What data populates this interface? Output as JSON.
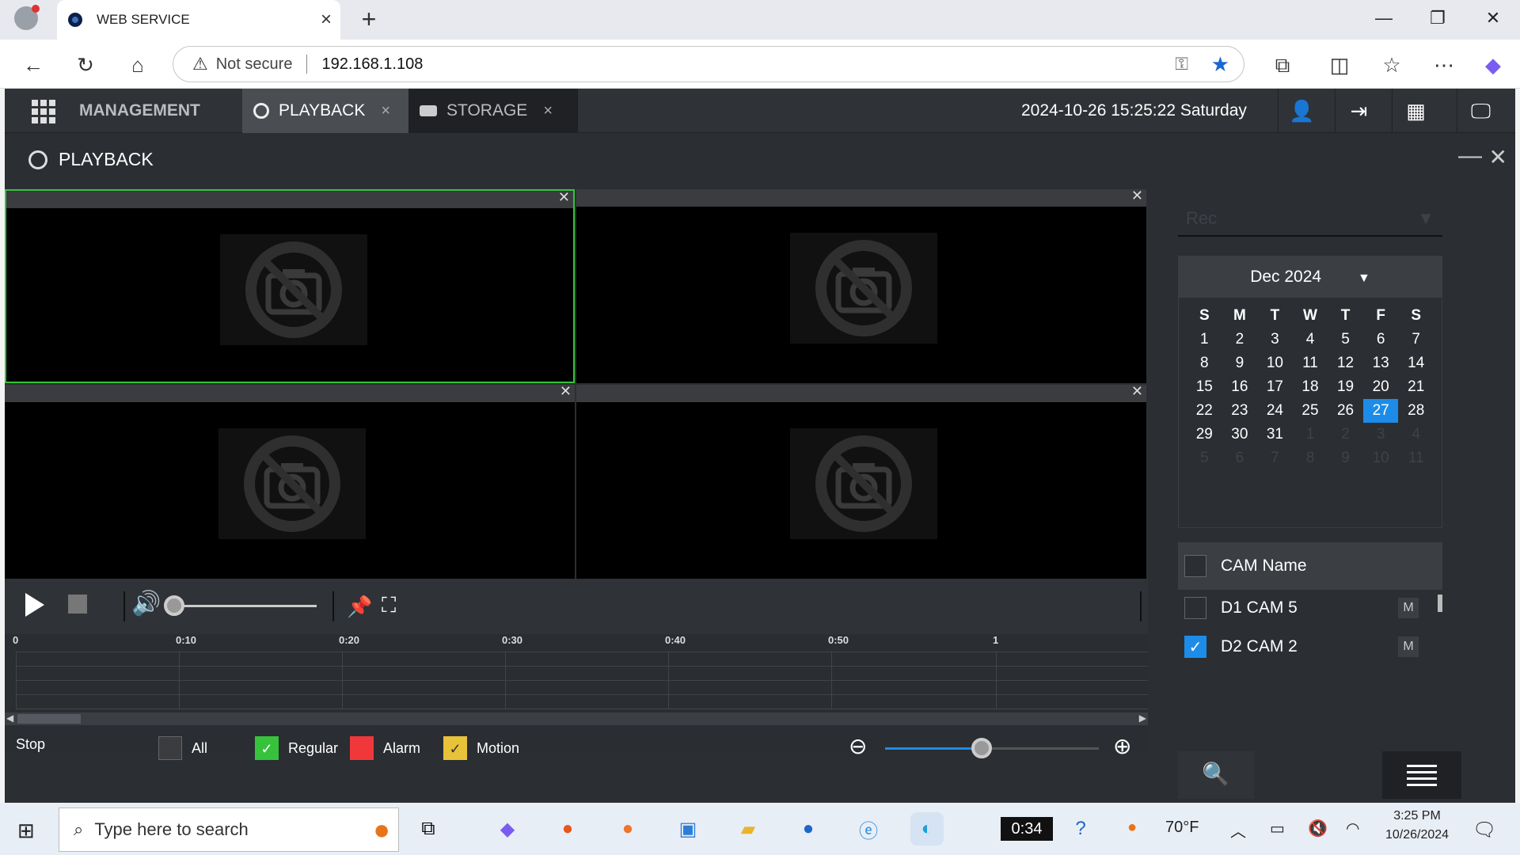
{
  "browser": {
    "tab_title": "WEB SERVICE",
    "security": "Not secure",
    "url": "192.168.1.108"
  },
  "app": {
    "tabs": [
      {
        "label": "MANAGEMENT"
      },
      {
        "label": "PLAYBACK",
        "close": "×"
      },
      {
        "label": "STORAGE",
        "close": "×"
      }
    ],
    "datetime": "2024-10-26 15:25:22 Saturday",
    "panel_title": "PLAYBACK",
    "timeline_ticks": [
      "0",
      "0:10",
      "0:20",
      "0:30",
      "0:40",
      "0:50",
      "1"
    ],
    "status": "Stop",
    "legend": [
      {
        "label": "All",
        "color": "#3a3c40"
      },
      {
        "label": "Regular",
        "color": "#37c23c"
      },
      {
        "label": "Alarm",
        "color": "#f0383a"
      },
      {
        "label": "Motion",
        "color": "#e8c33a"
      }
    ],
    "volume_level": 0.0,
    "zoom_level": 0.45
  },
  "sidebar": {
    "rec_placeholder": "Rec",
    "month": "Dec 2024",
    "weekdays": [
      "S",
      "M",
      "T",
      "W",
      "T",
      "F",
      "S"
    ],
    "days": [
      "1",
      "2",
      "3",
      "4",
      "5",
      "6",
      "7",
      "8",
      "9",
      "10",
      "11",
      "12",
      "13",
      "14",
      "15",
      "16",
      "17",
      "18",
      "19",
      "20",
      "21",
      "22",
      "23",
      "24",
      "25",
      "26",
      "27",
      "28",
      "29",
      "30",
      "31",
      "1",
      "2",
      "3",
      "4",
      "5",
      "6",
      "7",
      "8",
      "9",
      "10",
      "11"
    ],
    "selected_day": "27",
    "cam_header": "CAM Name",
    "cams": [
      {
        "name": "D1 CAM 5",
        "checked": false,
        "tag": "M"
      },
      {
        "name": "D2 CAM 2",
        "checked": true,
        "tag": "M"
      }
    ]
  },
  "taskbar": {
    "search_placeholder": "Type here to search",
    "timer": "0:34",
    "weather": "70°F",
    "time": "3:25 PM",
    "date": "10/26/2024"
  }
}
